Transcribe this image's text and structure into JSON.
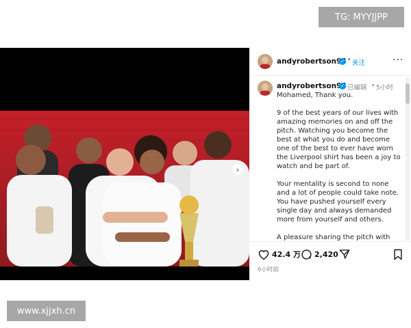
{
  "watermark_top": "TG: MYYJJPP",
  "watermark_bottom": "www.xjjxh.cn",
  "post": {
    "username": "andyrobertson94",
    "follow_label": "关注",
    "edited_label": "已编辑",
    "separator": "•",
    "time_short": "5小时",
    "caption_paragraphs": [
      "Mohamed, Thank you.",
      "9 of the best years of our lives with amazing memories on and off the pitch. Watching you become the best at what you do and become one of the best to ever have worn the Liverpool shirt has been a joy to watch and be part of.",
      "Your mentality is second to none and a lot of people could take note. You have pushed yourself every single day and always demanded more from yourself and others.",
      "A pleasure sharing the pitch with you for so long, but more so sharing a dressing room with you"
    ],
    "likes": "42.4 万",
    "comments": "2,420",
    "time_long": "6小时前"
  },
  "icons": {
    "verified": "verified-badge-icon",
    "more": "more-options-icon",
    "like": "heart-icon",
    "comment": "comment-icon",
    "share": "share-icon",
    "save": "bookmark-icon",
    "carousel": "chevron-right-icon"
  },
  "colors": {
    "accent": "#0095f6",
    "badge_bg": "#a7a7a7",
    "photo_frame": "#000000"
  }
}
